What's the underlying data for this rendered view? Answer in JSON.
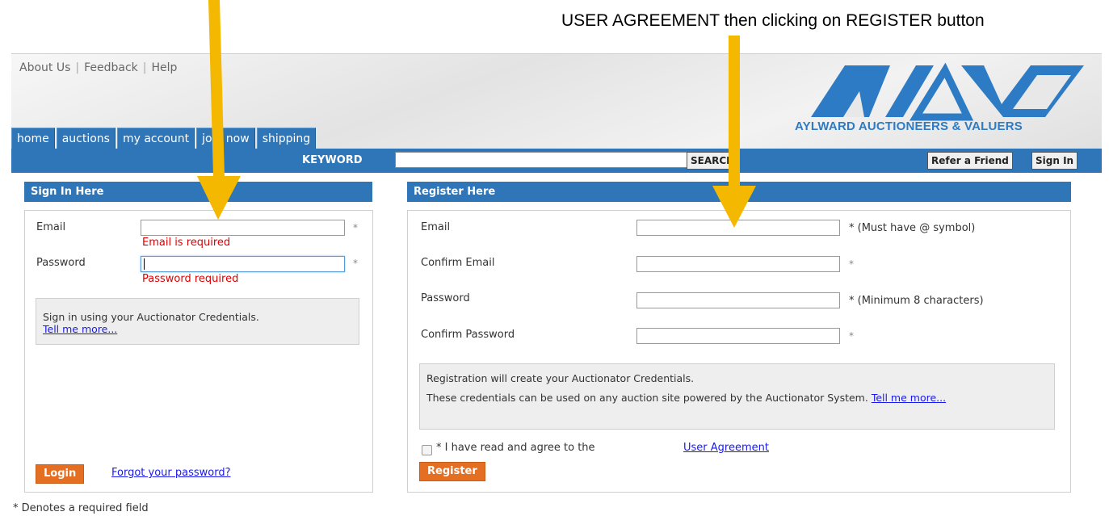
{
  "caption": "USER AGREEMENT then clicking on REGISTER button",
  "top_links": [
    "About Us",
    "Feedback",
    "Help"
  ],
  "logo_text": "AYLWARD AUCTIONEERS & VALUERS",
  "nav_tabs": [
    "home",
    "auctions",
    "my account",
    "join now",
    "shipping"
  ],
  "search": {
    "label": "KEYWORD",
    "value": "",
    "button": "SEARCH"
  },
  "header_buttons": {
    "refer": "Refer a Friend",
    "signin": "Sign In"
  },
  "signin": {
    "heading": "Sign In Here",
    "email_label": "Email",
    "email_error": "Email is required",
    "password_label": "Password",
    "password_error": "Password required",
    "required_mark": "*",
    "info_text": "Sign in using your Auctionator Credentials.",
    "info_link": "Tell me more...",
    "login_button": "Login",
    "forgot_link": "Forgot your password?"
  },
  "register": {
    "heading": "Register Here",
    "email_label": "Email",
    "email_hint": "* (Must have @ symbol)",
    "confirm_email_label": "Confirm Email",
    "password_label": "Password",
    "password_hint": "* (Minimum 8 characters)",
    "confirm_password_label": "Confirm Password",
    "required_mark": "*",
    "info_line1": "Registration will create your Auctionator Credentials.",
    "info_line2": "These credentials can be used on any auction site powered by the Auctionator System.",
    "info_link": "Tell me more...",
    "agree_prefix": "* I have read and agree to the",
    "agree_link": "User Agreement",
    "agree_checked": false,
    "register_button": "Register"
  },
  "footer_note": "* Denotes a required field",
  "colors": {
    "brand_blue": "#2f76b8",
    "accent_orange": "#e46f23",
    "arrow_yellow": "#f5b800",
    "error_red": "#e00000"
  }
}
